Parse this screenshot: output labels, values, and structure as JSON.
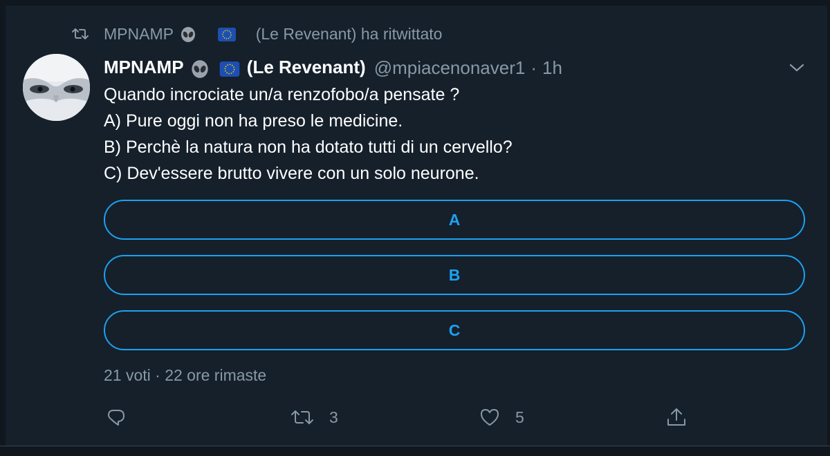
{
  "retweet_header": {
    "name": "MPNAMP",
    "suffix": "(Le Revenant) ha ritwittato"
  },
  "tweet": {
    "display_name_prefix": "MPNAMP",
    "display_name_suffix": "(Le Revenant)",
    "handle": "@mpiacenonaver1",
    "separator": "·",
    "time": "1h",
    "lines": [
      "Quando incrociate un/a renzofobo/a pensate ?",
      "A) Pure oggi non ha preso le medicine.",
      "B) Perchè la natura non ha dotato tutti di un cervello?",
      "C) Dev'essere brutto vivere con un solo neurone."
    ]
  },
  "poll": {
    "options": [
      "A",
      "B",
      "C"
    ],
    "meta": "21 voti · 22 ore rimaste"
  },
  "actions": {
    "reply_count": "",
    "retweet_count": "3",
    "like_count": "5"
  },
  "icons": [
    "retweet-icon",
    "alien-emoji-icon",
    "eu-flag-icon",
    "chevron-down-icon",
    "reply-icon",
    "like-icon",
    "share-icon"
  ],
  "colors": {
    "background": "#15202b",
    "accent": "#1da1f2",
    "secondary_text": "#8899a6"
  }
}
